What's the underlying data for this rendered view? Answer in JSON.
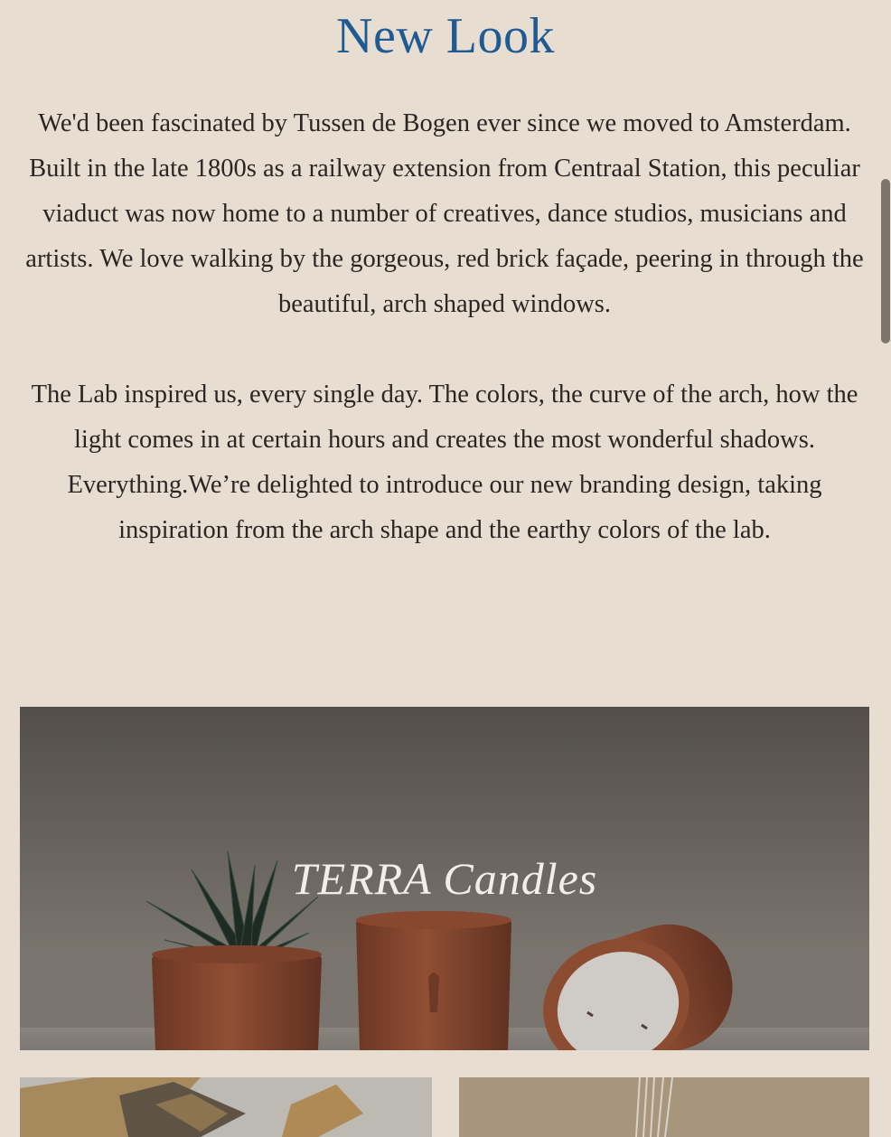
{
  "page": {
    "title": "New Look",
    "paragraphs": [
      "We'd been fascinated by Tussen de Bogen ever since we moved to Amsterdam. Built in the late 1800s as a railway extension from Centraal Station, this peculiar viaduct was now home to a number of creatives, dance studios, musicians and artists. We love walking by the gorgeous, red brick façade, peering in through the beautiful, arch shaped windows.",
      "The Lab inspired us, every single day. The colors, the curve of the arch, how the light comes in at certain hours and creates the most wonderful shadows. Everything.We’re delighted to introduce our new branding design, taking inspiration from the arch shape and the earthy colors of the lab."
    ]
  },
  "hero": {
    "title": "TERRA Candles"
  },
  "colors": {
    "background": "#e7ded1",
    "title": "#1f5a92",
    "body_text": "#2b2622",
    "terracotta": "#a4583a"
  }
}
